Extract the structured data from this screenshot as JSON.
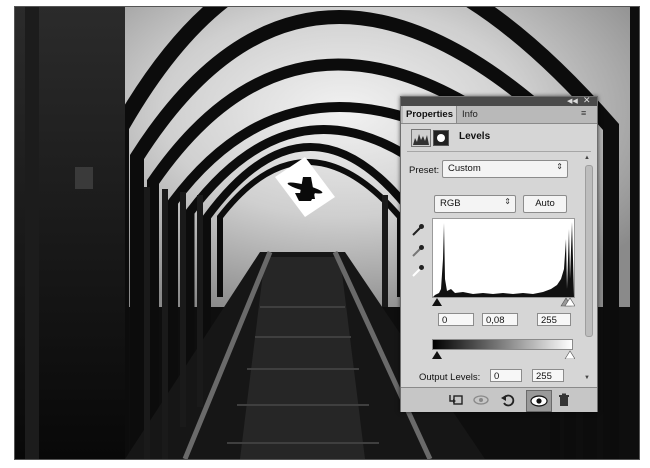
{
  "panel": {
    "tabs": [
      {
        "label": "Properties",
        "active": true
      },
      {
        "label": "Info",
        "active": false
      }
    ],
    "collapse_icon": "double-chevron-left-icon",
    "close_icon": "close-icon",
    "menu_icon": "panel-menu-icon",
    "adjustment": {
      "title": "Levels",
      "icon": "levels-icon",
      "mask_icon": "layer-mask-icon"
    },
    "preset": {
      "label": "Preset:",
      "value": "Custom"
    },
    "channel": {
      "value": "RGB"
    },
    "auto_label": "Auto",
    "eyedroppers": [
      "black-point-eyedropper-icon",
      "gray-point-eyedropper-icon",
      "white-point-eyedropper-icon"
    ],
    "input_levels": {
      "black": "0",
      "midtone": "0,08",
      "white": "255"
    },
    "output_levels": {
      "label": "Output Levels:",
      "black": "0",
      "white": "255"
    },
    "bottom_icons": [
      "clip-to-layer-icon",
      "view-previous-icon",
      "reset-icon",
      "visibility-eye-icon",
      "trash-icon"
    ]
  },
  "colors": {
    "panel_bg": "#d6d6d6",
    "panel_header": "#4a4a4a",
    "tab_bar": "#b9b9b9",
    "bottom_bar": "#c6c6c6"
  }
}
